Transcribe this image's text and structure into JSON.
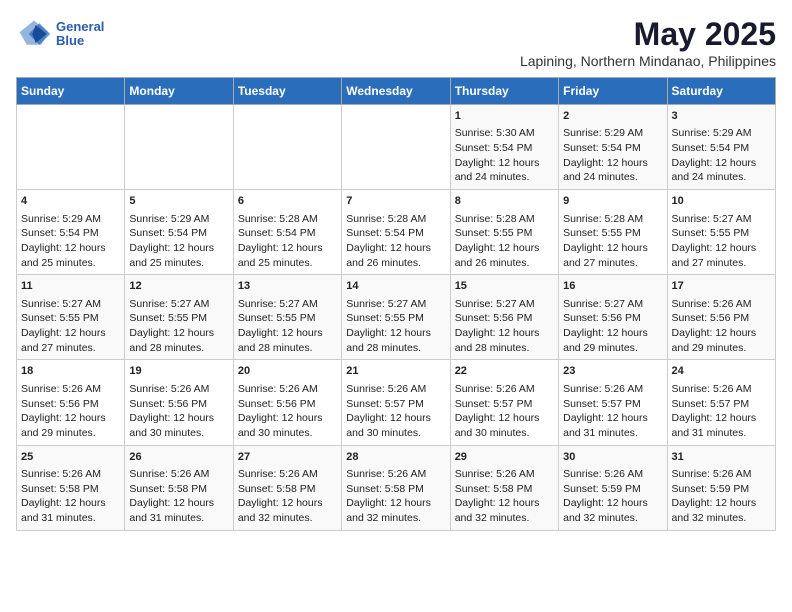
{
  "header": {
    "logo_line1": "General",
    "logo_line2": "Blue",
    "title": "May 2025",
    "subtitle": "Lapining, Northern Mindanao, Philippines"
  },
  "calendar": {
    "days_of_week": [
      "Sunday",
      "Monday",
      "Tuesday",
      "Wednesday",
      "Thursday",
      "Friday",
      "Saturday"
    ],
    "weeks": [
      [
        {
          "day": "",
          "content": ""
        },
        {
          "day": "",
          "content": ""
        },
        {
          "day": "",
          "content": ""
        },
        {
          "day": "",
          "content": ""
        },
        {
          "day": "1",
          "content": "Sunrise: 5:30 AM\nSunset: 5:54 PM\nDaylight: 12 hours\nand 24 minutes."
        },
        {
          "day": "2",
          "content": "Sunrise: 5:29 AM\nSunset: 5:54 PM\nDaylight: 12 hours\nand 24 minutes."
        },
        {
          "day": "3",
          "content": "Sunrise: 5:29 AM\nSunset: 5:54 PM\nDaylight: 12 hours\nand 24 minutes."
        }
      ],
      [
        {
          "day": "4",
          "content": "Sunrise: 5:29 AM\nSunset: 5:54 PM\nDaylight: 12 hours\nand 25 minutes."
        },
        {
          "day": "5",
          "content": "Sunrise: 5:29 AM\nSunset: 5:54 PM\nDaylight: 12 hours\nand 25 minutes."
        },
        {
          "day": "6",
          "content": "Sunrise: 5:28 AM\nSunset: 5:54 PM\nDaylight: 12 hours\nand 25 minutes."
        },
        {
          "day": "7",
          "content": "Sunrise: 5:28 AM\nSunset: 5:54 PM\nDaylight: 12 hours\nand 26 minutes."
        },
        {
          "day": "8",
          "content": "Sunrise: 5:28 AM\nSunset: 5:55 PM\nDaylight: 12 hours\nand 26 minutes."
        },
        {
          "day": "9",
          "content": "Sunrise: 5:28 AM\nSunset: 5:55 PM\nDaylight: 12 hours\nand 27 minutes."
        },
        {
          "day": "10",
          "content": "Sunrise: 5:27 AM\nSunset: 5:55 PM\nDaylight: 12 hours\nand 27 minutes."
        }
      ],
      [
        {
          "day": "11",
          "content": "Sunrise: 5:27 AM\nSunset: 5:55 PM\nDaylight: 12 hours\nand 27 minutes."
        },
        {
          "day": "12",
          "content": "Sunrise: 5:27 AM\nSunset: 5:55 PM\nDaylight: 12 hours\nand 28 minutes."
        },
        {
          "day": "13",
          "content": "Sunrise: 5:27 AM\nSunset: 5:55 PM\nDaylight: 12 hours\nand 28 minutes."
        },
        {
          "day": "14",
          "content": "Sunrise: 5:27 AM\nSunset: 5:55 PM\nDaylight: 12 hours\nand 28 minutes."
        },
        {
          "day": "15",
          "content": "Sunrise: 5:27 AM\nSunset: 5:56 PM\nDaylight: 12 hours\nand 28 minutes."
        },
        {
          "day": "16",
          "content": "Sunrise: 5:27 AM\nSunset: 5:56 PM\nDaylight: 12 hours\nand 29 minutes."
        },
        {
          "day": "17",
          "content": "Sunrise: 5:26 AM\nSunset: 5:56 PM\nDaylight: 12 hours\nand 29 minutes."
        }
      ],
      [
        {
          "day": "18",
          "content": "Sunrise: 5:26 AM\nSunset: 5:56 PM\nDaylight: 12 hours\nand 29 minutes."
        },
        {
          "day": "19",
          "content": "Sunrise: 5:26 AM\nSunset: 5:56 PM\nDaylight: 12 hours\nand 30 minutes."
        },
        {
          "day": "20",
          "content": "Sunrise: 5:26 AM\nSunset: 5:56 PM\nDaylight: 12 hours\nand 30 minutes."
        },
        {
          "day": "21",
          "content": "Sunrise: 5:26 AM\nSunset: 5:57 PM\nDaylight: 12 hours\nand 30 minutes."
        },
        {
          "day": "22",
          "content": "Sunrise: 5:26 AM\nSunset: 5:57 PM\nDaylight: 12 hours\nand 30 minutes."
        },
        {
          "day": "23",
          "content": "Sunrise: 5:26 AM\nSunset: 5:57 PM\nDaylight: 12 hours\nand 31 minutes."
        },
        {
          "day": "24",
          "content": "Sunrise: 5:26 AM\nSunset: 5:57 PM\nDaylight: 12 hours\nand 31 minutes."
        }
      ],
      [
        {
          "day": "25",
          "content": "Sunrise: 5:26 AM\nSunset: 5:58 PM\nDaylight: 12 hours\nand 31 minutes."
        },
        {
          "day": "26",
          "content": "Sunrise: 5:26 AM\nSunset: 5:58 PM\nDaylight: 12 hours\nand 31 minutes."
        },
        {
          "day": "27",
          "content": "Sunrise: 5:26 AM\nSunset: 5:58 PM\nDaylight: 12 hours\nand 32 minutes."
        },
        {
          "day": "28",
          "content": "Sunrise: 5:26 AM\nSunset: 5:58 PM\nDaylight: 12 hours\nand 32 minutes."
        },
        {
          "day": "29",
          "content": "Sunrise: 5:26 AM\nSunset: 5:58 PM\nDaylight: 12 hours\nand 32 minutes."
        },
        {
          "day": "30",
          "content": "Sunrise: 5:26 AM\nSunset: 5:59 PM\nDaylight: 12 hours\nand 32 minutes."
        },
        {
          "day": "31",
          "content": "Sunrise: 5:26 AM\nSunset: 5:59 PM\nDaylight: 12 hours\nand 32 minutes."
        }
      ]
    ]
  }
}
